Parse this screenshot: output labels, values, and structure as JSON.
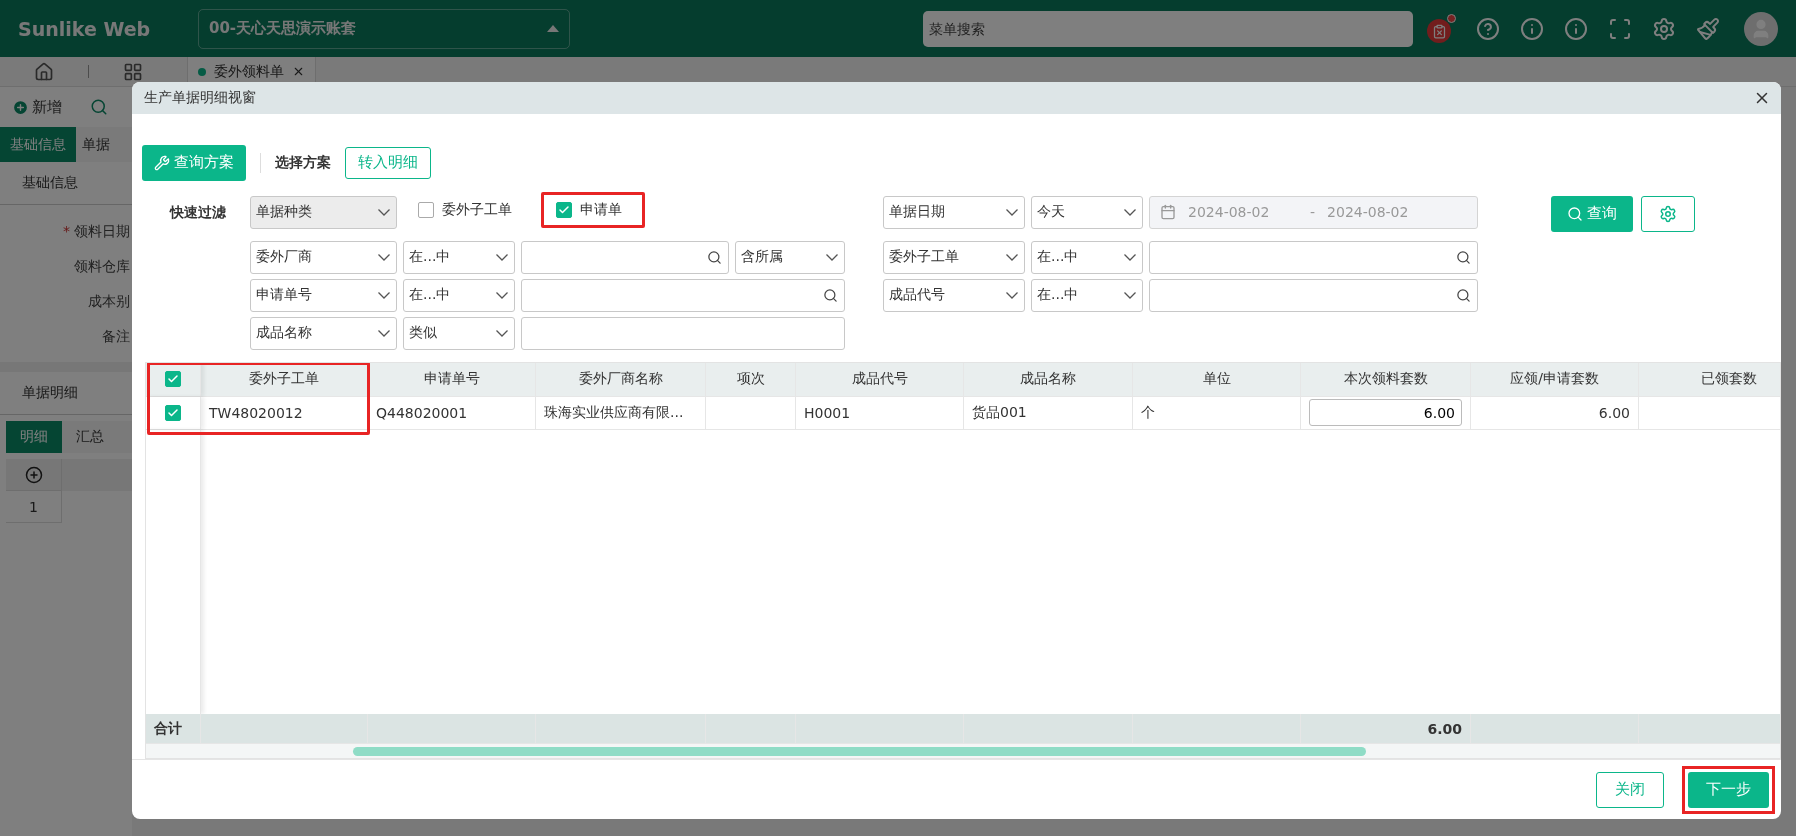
{
  "header": {
    "logo": "Sunlike Web",
    "account": "00-天心天思演示账套",
    "search": {
      "placeholder": "菜单搜索"
    }
  },
  "page_tabs": [
    {
      "label": "委外领料单"
    }
  ],
  "page": {
    "add_button": "新增",
    "required_mark": "*",
    "tabs": [
      {
        "label": "基础信息",
        "selected": true
      },
      {
        "label": "单据",
        "selected": false
      }
    ],
    "section": "基础信息",
    "fields": [
      {
        "label": "领料日期",
        "required": true
      },
      {
        "label": "领料仓库",
        "required": false
      },
      {
        "label": "成本别",
        "required": false
      },
      {
        "label": "备注",
        "required": false
      }
    ],
    "detail_title": "单据明细",
    "detail_tabs": [
      {
        "label": "明细",
        "selected": true
      },
      {
        "label": "汇总",
        "selected": false
      }
    ],
    "detail_rows": [
      "1"
    ]
  },
  "dialog": {
    "title": "生产单据明细视窗",
    "toolbar": {
      "scheme_button": "查询方案",
      "scheme_label": "选择方案",
      "transfer_button": "转入明细"
    },
    "filter_label": "快速过滤",
    "filter_rows": [
      {
        "left": [
          {
            "kind": "select",
            "value": "单据种类",
            "disabled": true
          },
          {
            "kind": "checkbox",
            "label": "委外子工单",
            "checked": false,
            "highlighted": false
          },
          {
            "kind": "checkbox",
            "label": "申请单",
            "checked": true,
            "highlighted": true
          }
        ],
        "right": [
          {
            "kind": "select",
            "value": "单据日期",
            "disabled": false
          },
          {
            "kind": "select",
            "value": "今天",
            "disabled": false
          },
          {
            "kind": "date_range",
            "from": "2024-08-02",
            "separator": "-",
            "to": "2024-08-02",
            "disabled": true
          }
        ]
      },
      {
        "left": [
          {
            "kind": "select",
            "value": "委外厂商",
            "disabled": false
          },
          {
            "kind": "select",
            "value": "在...中",
            "disabled": false
          },
          {
            "kind": "search"
          },
          {
            "kind": "select",
            "value": "含所属",
            "disabled": false
          }
        ],
        "right": [
          {
            "kind": "select",
            "value": "委外子工单",
            "disabled": false
          },
          {
            "kind": "select",
            "value": "在...中",
            "disabled": false
          },
          {
            "kind": "search"
          }
        ]
      },
      {
        "left": [
          {
            "kind": "select",
            "value": "申请单号",
            "disabled": false
          },
          {
            "kind": "select",
            "value": "在...中",
            "disabled": false
          },
          {
            "kind": "search"
          }
        ],
        "right": [
          {
            "kind": "select",
            "value": "成品代号",
            "disabled": false
          },
          {
            "kind": "select",
            "value": "在...中",
            "disabled": false
          },
          {
            "kind": "search"
          }
        ]
      },
      {
        "left": [
          {
            "kind": "select",
            "value": "成品名称",
            "disabled": false
          },
          {
            "kind": "select",
            "value": "类似",
            "disabled": false
          },
          {
            "kind": "input"
          }
        ]
      }
    ],
    "query_button": "查询",
    "table": {
      "all_selected": true,
      "highlight_first_column": true,
      "columns": [
        {
          "label": "委外子工单",
          "kind": "text"
        },
        {
          "label": "申请单号",
          "kind": "text"
        },
        {
          "label": "委外厂商名称",
          "kind": "text"
        },
        {
          "label": "项次",
          "kind": "text"
        },
        {
          "label": "成品代号",
          "kind": "text"
        },
        {
          "label": "成品名称",
          "kind": "text"
        },
        {
          "label": "单位",
          "kind": "text"
        },
        {
          "label": "本次领料套数",
          "kind": "number_input",
          "total": "6.00"
        },
        {
          "label": "应领/申请套数",
          "kind": "number"
        },
        {
          "label": "已领套数",
          "kind": "number"
        }
      ],
      "rows": [
        {
          "selected": true,
          "cells": [
            "TW48020012",
            "Q448020001",
            "珠海实业供应商有限...",
            null,
            "H0001",
            "货品001",
            "个",
            "6.00",
            "6.00",
            null
          ]
        }
      ],
      "totals_label": "合计"
    },
    "buttons": [
      {
        "label": "关闭",
        "kind": "secondary",
        "highlighted": false
      },
      {
        "label": "下一步",
        "kind": "primary",
        "highlighted": true
      }
    ]
  }
}
